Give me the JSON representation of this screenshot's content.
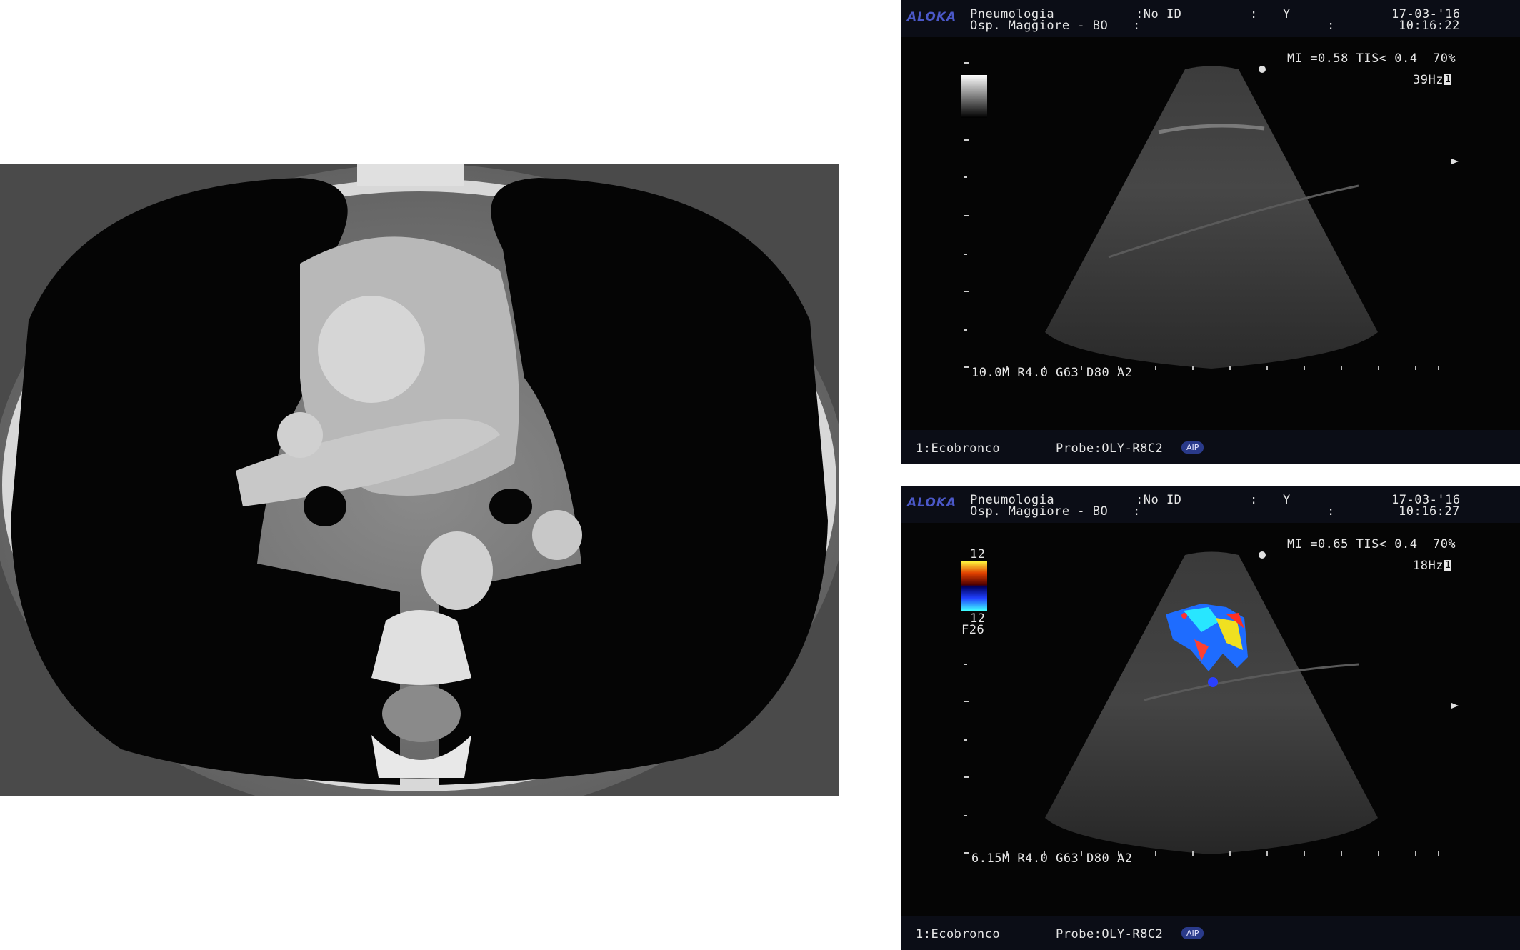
{
  "ultrasound_top": {
    "brand": "ALOKA",
    "dept": "Pneumologia",
    "hospital": "Osp. Maggiore - BO",
    "id_label": ":No ID",
    "colon1": ":",
    "colon2": ":",
    "y_label": "Y",
    "colon3": ":",
    "date": "17-03-'16",
    "time": "10:16:22",
    "mi_line": "MI =0.58 TIS< 0.4  70%",
    "freq": "39Hz",
    "freq_marker": "1",
    "params": "10.0M R4.0 G63 D80 A2",
    "preset": "1:Ecobronco",
    "probe": "Probe:OLY-R8C2",
    "aip": "AIP"
  },
  "ultrasound_bottom": {
    "brand": "ALOKA",
    "dept": "Pneumologia",
    "hospital": "Osp. Maggiore - BO",
    "id_label": ":No ID",
    "colon1": ":",
    "colon2": ":",
    "y_label": "Y",
    "colon3": ":",
    "date": "17-03-'16",
    "time": "10:16:27",
    "mi_line": "MI =0.65 TIS< 0.4  70%",
    "freq": "18Hz",
    "freq_marker": "1",
    "scale_top": "12",
    "scale_bottom": "12",
    "filter": "F26",
    "params": "6.15M R4.0 G63 D80 A2",
    "preset": "1:Ecobronco",
    "probe": "Probe:OLY-R8C2",
    "aip": "AIP"
  },
  "colors": {
    "brand_blue": "#4b58c8",
    "overlay_text": "#e6e6e6",
    "header_bg": "#0b0d16",
    "aip_badge": "#2a3a8a"
  }
}
